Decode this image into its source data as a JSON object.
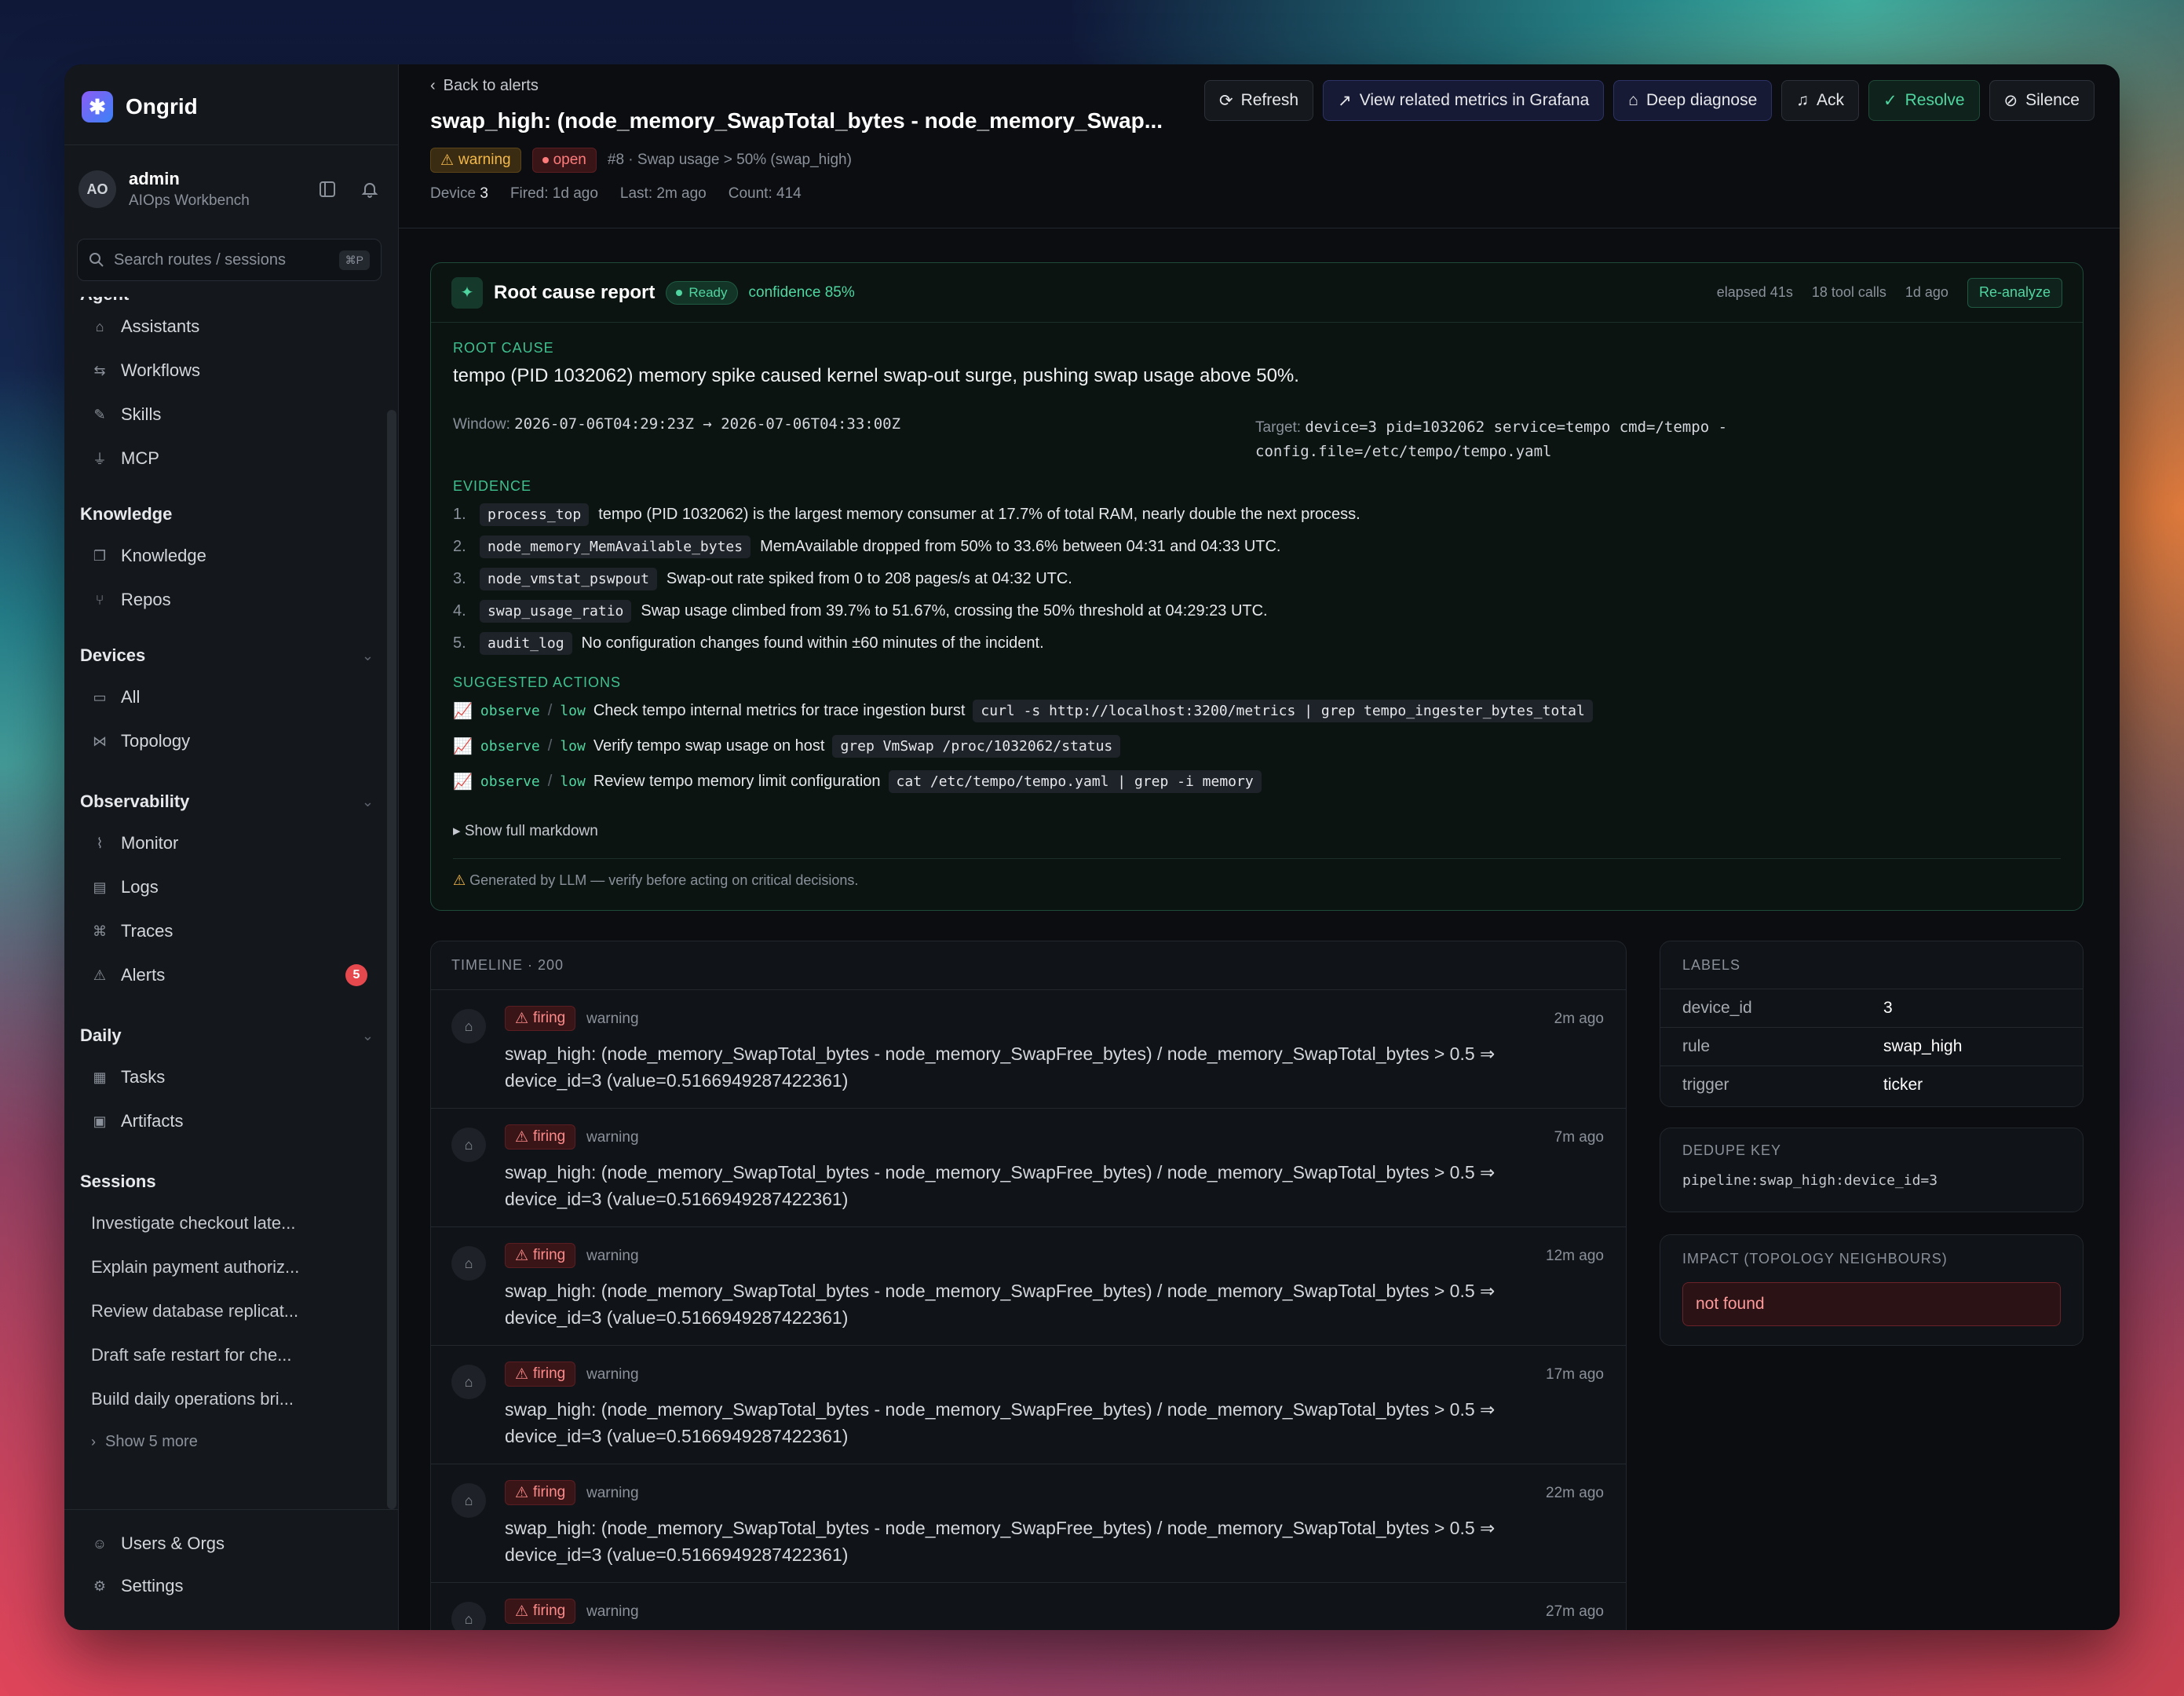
{
  "app": {
    "name": "Ongrid"
  },
  "user": {
    "initials": "AO",
    "name": "admin",
    "role": "AIOps Workbench"
  },
  "search": {
    "placeholder": "Search routes / sessions",
    "shortcut": "⌘P"
  },
  "nav": {
    "agent_section": "Agent",
    "agent": [
      {
        "label": "Assistants"
      },
      {
        "label": "Workflows"
      },
      {
        "label": "Skills"
      },
      {
        "label": "MCP"
      }
    ],
    "knowledge_section": "Knowledge",
    "knowledge": [
      {
        "label": "Knowledge"
      },
      {
        "label": "Repos"
      }
    ],
    "devices_section": "Devices",
    "devices": [
      {
        "label": "All"
      },
      {
        "label": "Topology"
      }
    ],
    "observability_section": "Observability",
    "observability": [
      {
        "label": "Monitor"
      },
      {
        "label": "Logs"
      },
      {
        "label": "Traces"
      },
      {
        "label": "Alerts",
        "badge": "5"
      }
    ],
    "daily_section": "Daily",
    "daily": [
      {
        "label": "Tasks"
      },
      {
        "label": "Artifacts"
      }
    ],
    "sessions_section": "Sessions",
    "sessions": [
      "Investigate checkout late...",
      "Explain payment authoriz...",
      "Review database replicat...",
      "Draft safe restart for che...",
      "Build daily operations bri..."
    ],
    "show_more": "Show 5 more",
    "footer": [
      {
        "label": "Users & Orgs"
      },
      {
        "label": "Settings"
      }
    ]
  },
  "header": {
    "back": "Back to alerts",
    "title": "swap_high: (node_memory_SwapTotal_bytes - node_memory_Swap...",
    "severity": "warning",
    "status": "open",
    "rule": "#8 · Swap usage > 50% (swap_high)",
    "device_label": "Device",
    "device_value": "3",
    "fired": "Fired: 1d ago",
    "last": "Last: 2m ago",
    "count": "Count: 414",
    "actions": {
      "refresh": "Refresh",
      "grafana": "View related metrics in Grafana",
      "deep": "Deep diagnose",
      "ack": "Ack",
      "resolve": "Resolve",
      "silence": "Silence"
    }
  },
  "rca": {
    "title": "Root cause report",
    "status": "Ready",
    "confidence": "confidence 85%",
    "elapsed": "elapsed 41s",
    "tool_calls": "18 tool calls",
    "ago": "1d ago",
    "reanalyze": "Re-analyze",
    "root_cause_label": "ROOT CAUSE",
    "root_cause": "tempo (PID 1032062) memory spike caused kernel swap-out surge, pushing swap usage above 50%.",
    "window_label": "Window:",
    "window": "2026-07-06T04:29:23Z → 2026-07-06T04:33:00Z",
    "target_label": "Target:",
    "target_line1": "device=3 pid=1032062 service=tempo cmd=/tempo -",
    "target_line2": "config.file=/etc/tempo/tempo.yaml",
    "evidence_label": "EVIDENCE",
    "evidence": [
      {
        "n": "1.",
        "code": "process_top",
        "text": "tempo (PID 1032062) is the largest memory consumer at 17.7% of total RAM, nearly double the next process."
      },
      {
        "n": "2.",
        "code": "node_memory_MemAvailable_bytes",
        "text": "MemAvailable dropped from 50% to 33.6% between 04:31 and 04:33 UTC."
      },
      {
        "n": "3.",
        "code": "node_vmstat_pswpout",
        "text": "Swap-out rate spiked from 0 to 208 pages/s at 04:32 UTC."
      },
      {
        "n": "4.",
        "code": "swap_usage_ratio",
        "text": "Swap usage climbed from 39.7% to 51.67%, crossing the 50% threshold at 04:29:23 UTC."
      },
      {
        "n": "5.",
        "code": "audit_log",
        "text": "No configuration changes found within ±60 minutes of the incident."
      }
    ],
    "actions_label": "SUGGESTED ACTIONS",
    "suggested": [
      {
        "kind": "observe",
        "risk": "low",
        "text": "Check tempo internal metrics for trace ingestion burst",
        "cmd": "curl -s http://localhost:3200/metrics | grep tempo_ingester_bytes_total"
      },
      {
        "kind": "observe",
        "risk": "low",
        "text": "Verify tempo swap usage on host",
        "cmd": "grep VmSwap /proc/1032062/status"
      },
      {
        "kind": "observe",
        "risk": "low",
        "text": "Review tempo memory limit configuration",
        "cmd": "cat /etc/tempo/tempo.yaml | grep -i memory"
      }
    ],
    "show_markdown": "Show full markdown",
    "llm_warning": "Generated by LLM — verify before acting on critical decisions."
  },
  "timeline": {
    "title": "TIMELINE · 200",
    "events": [
      {
        "state": "firing",
        "severity": "warning",
        "ago": "2m ago",
        "text": "swap_high: (node_memory_SwapTotal_bytes - node_memory_SwapFree_bytes) / node_memory_SwapTotal_bytes > 0.5 ⇒ device_id=3 (value=0.5166949287422361)"
      },
      {
        "state": "firing",
        "severity": "warning",
        "ago": "7m ago",
        "text": "swap_high: (node_memory_SwapTotal_bytes - node_memory_SwapFree_bytes) / node_memory_SwapTotal_bytes > 0.5 ⇒ device_id=3 (value=0.5166949287422361)"
      },
      {
        "state": "firing",
        "severity": "warning",
        "ago": "12m ago",
        "text": "swap_high: (node_memory_SwapTotal_bytes - node_memory_SwapFree_bytes) / node_memory_SwapTotal_bytes > 0.5 ⇒ device_id=3 (value=0.5166949287422361)"
      },
      {
        "state": "firing",
        "severity": "warning",
        "ago": "17m ago",
        "text": "swap_high: (node_memory_SwapTotal_bytes - node_memory_SwapFree_bytes) / node_memory_SwapTotal_bytes > 0.5 ⇒ device_id=3 (value=0.5166949287422361)"
      },
      {
        "state": "firing",
        "severity": "warning",
        "ago": "22m ago",
        "text": "swap_high: (node_memory_SwapTotal_bytes - node_memory_SwapFree_bytes) / node_memory_SwapTotal_bytes > 0.5 ⇒ device_id=3 (value=0.5166949287422361)"
      },
      {
        "state": "firing",
        "severity": "warning",
        "ago": "27m ago",
        "text": ""
      }
    ]
  },
  "labels": {
    "title": "LABELS",
    "rows": [
      {
        "k": "device_id",
        "v": "3"
      },
      {
        "k": "rule",
        "v": "swap_high"
      },
      {
        "k": "trigger",
        "v": "ticker"
      }
    ]
  },
  "dedupe": {
    "title": "DEDUPE KEY",
    "value": "pipeline:swap_high:device_id=3"
  },
  "impact": {
    "title": "IMPACT (TOPOLOGY NEIGHBOURS)",
    "value": "not found"
  }
}
